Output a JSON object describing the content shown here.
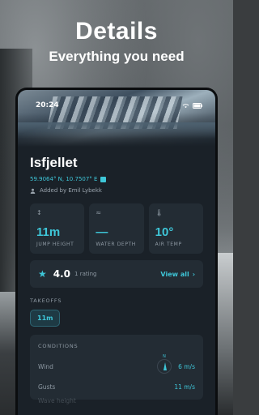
{
  "hero": {
    "title": "Details",
    "subtitle": "Everything you need"
  },
  "status": {
    "time": "20:24"
  },
  "spot": {
    "name": "Isfjellet",
    "coordinates": "59.9064° N, 10.7507° E",
    "added_by": "Added by Emil Lybekk"
  },
  "stats": [
    {
      "icon": "height-arrows-icon",
      "value": "11m",
      "label": "JUMP HEIGHT"
    },
    {
      "icon": "wave-icon",
      "value": "—",
      "label": "WATER DEPTH"
    },
    {
      "icon": "thermometer-icon",
      "value": "10°",
      "label": "AIR TEMP"
    }
  ],
  "rating": {
    "value": "4.0",
    "count": "1 rating",
    "view_all": "View all"
  },
  "takeoffs": {
    "label": "TAKEOFFS",
    "items": [
      "11m"
    ]
  },
  "conditions": {
    "title": "CONDITIONS",
    "rows": [
      {
        "key": "Wind",
        "value": "6 m/s",
        "compass_label": "N"
      },
      {
        "key": "Gusts",
        "value": "11 m/s"
      }
    ],
    "partial_row": "Wave height"
  },
  "colors": {
    "accent": "#3ec6d8",
    "card": "#232c34",
    "screen": "#1a2128"
  }
}
